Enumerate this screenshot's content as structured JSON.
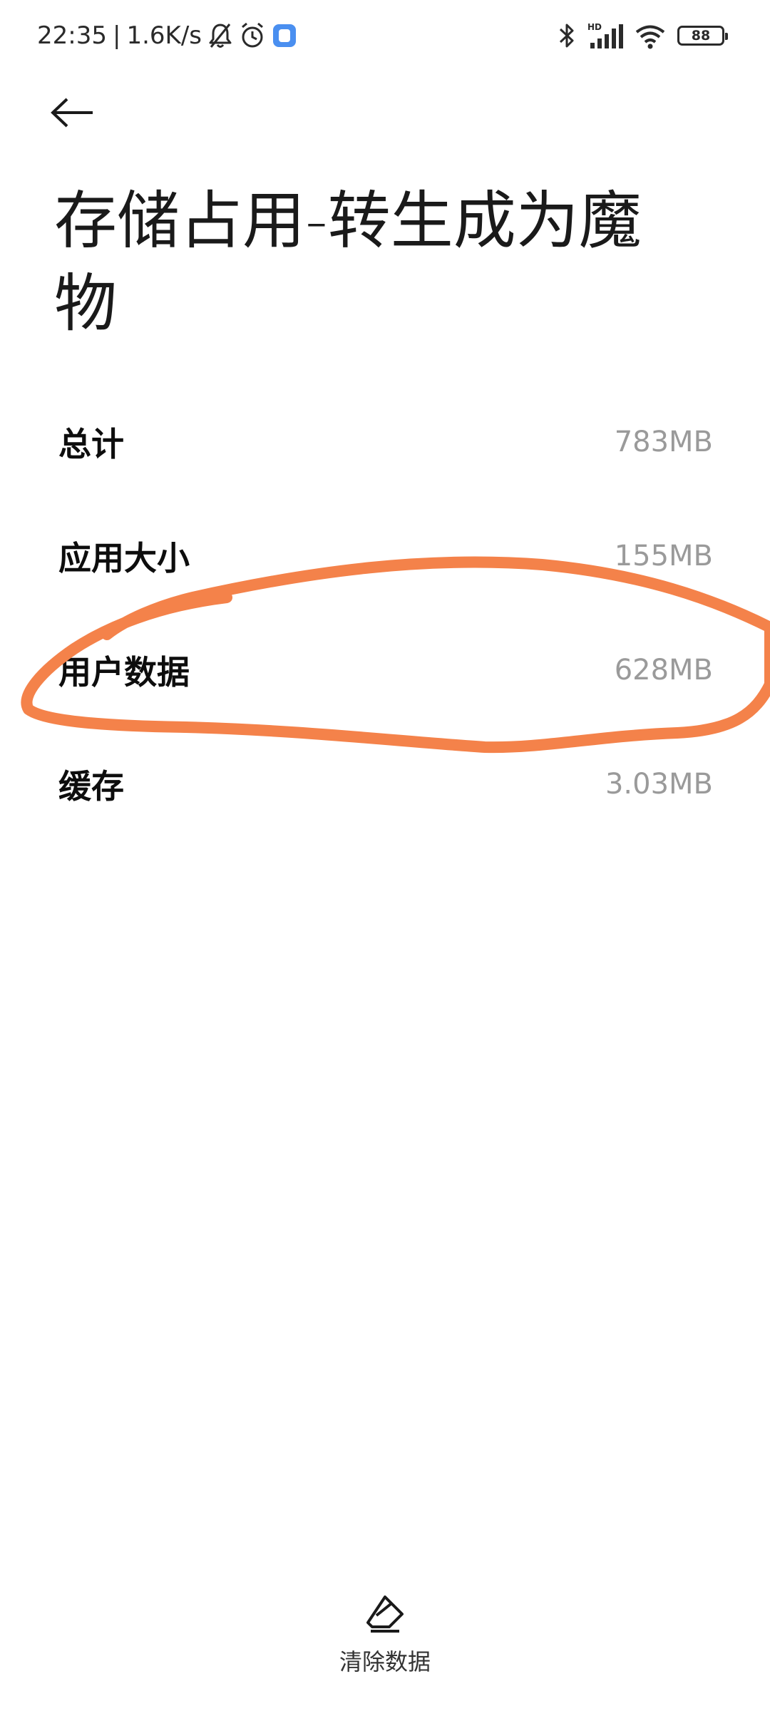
{
  "status_bar": {
    "time": "22:35",
    "separator": "|",
    "net_speed": "1.6K/s",
    "icons_left": [
      "bell-off-icon",
      "alarm-icon",
      "app-notification-icon"
    ],
    "icons_right": [
      "bluetooth-icon",
      "hd-signal-icon",
      "wifi-icon",
      "battery-icon"
    ],
    "hd_label": "HD",
    "battery_level": "88"
  },
  "header": {
    "back_icon": "arrow-left-icon",
    "title": "存储占用-转生成为魔物"
  },
  "storage": {
    "items": [
      {
        "label": "总计",
        "value": "783MB"
      },
      {
        "label": "应用大小",
        "value": "155MB"
      },
      {
        "label": "用户数据",
        "value": "628MB"
      },
      {
        "label": "缓存",
        "value": "3.03MB"
      }
    ]
  },
  "bottom_action": {
    "icon": "eraser-icon",
    "label": "清除数据"
  },
  "colors": {
    "annotation_stroke": "#F4824A",
    "app_icon": "#4A8FF0",
    "value_text": "#9A9A9A"
  }
}
